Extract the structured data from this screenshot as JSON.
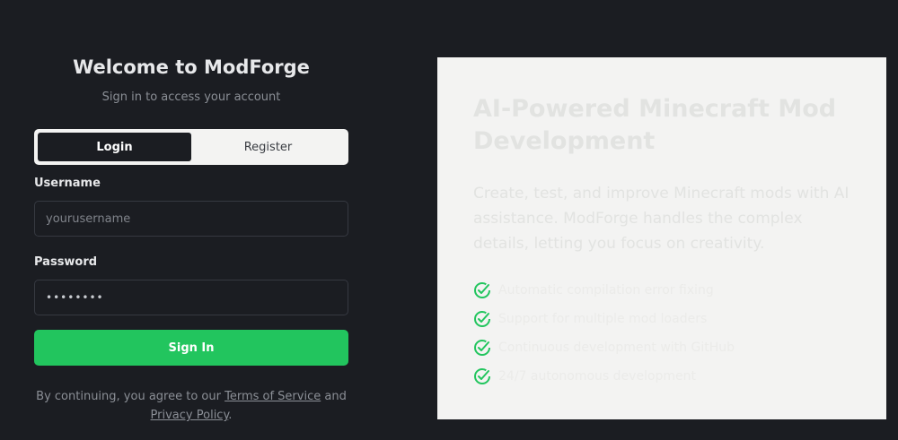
{
  "auth": {
    "title": "Welcome to ModForge",
    "subtitle": "Sign in to access your account",
    "tabs": [
      {
        "label": "Login",
        "active": true
      },
      {
        "label": "Register",
        "active": false
      }
    ],
    "username": {
      "label": "Username",
      "placeholder": "yourusername",
      "value": ""
    },
    "password": {
      "label": "Password",
      "value": "••••••••"
    },
    "submit_label": "Sign In",
    "legal": {
      "prefix": "By continuing, you agree to our",
      "terms": "Terms of Service",
      "and": "and",
      "privacy": "Privacy Policy",
      "suffix": "."
    }
  },
  "promo": {
    "title": "AI-Powered Minecraft Mod Development",
    "description": "Create, test, and improve Minecraft mods with AI assistance. ModForge handles the complex details, letting you focus on creativity.",
    "features": [
      "Automatic compilation error fixing",
      "Support for multiple mod loaders",
      "Continuous development with GitHub",
      "24/7 autonomous development"
    ]
  },
  "colors": {
    "accent": "#22c55e",
    "background": "#1b1d22",
    "panel": "#f3f3f2"
  }
}
